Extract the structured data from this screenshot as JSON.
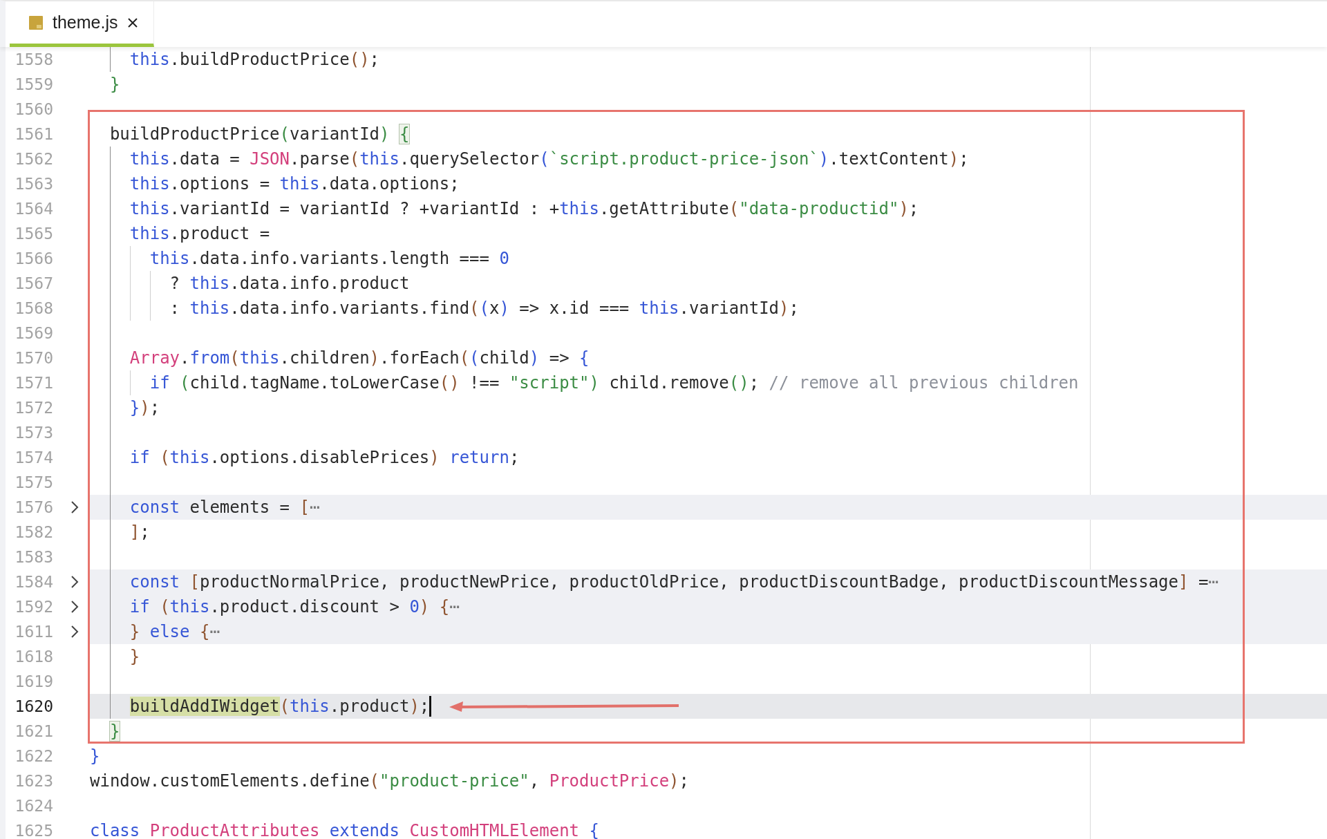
{
  "tabs": [
    {
      "label": "theme.js",
      "selected": true
    }
  ],
  "editor": {
    "lines": [
      {
        "number": "1558",
        "folded": false,
        "current": false,
        "tokens": [
          {
            "text": "    this",
            "kind": "kw"
          },
          {
            "text": ".buildProductPrice",
            "kind": "plain"
          },
          {
            "text": "()",
            "kind": "b1"
          },
          {
            "text": ";",
            "kind": "plain"
          }
        ]
      },
      {
        "number": "1559",
        "folded": false,
        "current": false,
        "tokens": [
          {
            "text": "  }",
            "kind": "b3"
          }
        ]
      },
      {
        "number": "1560",
        "folded": false,
        "current": false
      },
      {
        "number": "1561",
        "folded": false,
        "current": false,
        "tokens": [
          {
            "text": "  buildProductPrice",
            "kind": "plain"
          },
          {
            "text": "(",
            "kind": "b3"
          },
          {
            "text": "variantId",
            "kind": "plain"
          },
          {
            "text": ") ",
            "kind": "b3"
          },
          {
            "text": "{",
            "kind": "match"
          }
        ]
      },
      {
        "number": "1562",
        "folded": false,
        "current": false,
        "tokens": [
          {
            "text": "    this",
            "kind": "kw"
          },
          {
            "text": ".data = ",
            "kind": "plain"
          },
          {
            "text": "JSON",
            "kind": "type"
          },
          {
            "text": ".parse",
            "kind": "plain"
          },
          {
            "text": "(",
            "kind": "b1"
          },
          {
            "text": "this",
            "kind": "kw"
          },
          {
            "text": ".querySelector",
            "kind": "plain"
          },
          {
            "text": "(",
            "kind": "b2"
          },
          {
            "text": "`script.product-price-json`",
            "kind": "str"
          },
          {
            "text": ")",
            "kind": "b2"
          },
          {
            "text": ".textContent",
            "kind": "plain"
          },
          {
            "text": ")",
            "kind": "b1"
          },
          {
            "text": ";",
            "kind": "plain"
          }
        ]
      },
      {
        "number": "1563",
        "folded": false,
        "current": false,
        "tokens": [
          {
            "text": "    this",
            "kind": "kw"
          },
          {
            "text": ".options = ",
            "kind": "plain"
          },
          {
            "text": "this",
            "kind": "kw"
          },
          {
            "text": ".data.options;",
            "kind": "plain"
          }
        ]
      },
      {
        "number": "1564",
        "folded": false,
        "current": false,
        "tokens": [
          {
            "text": "    this",
            "kind": "kw"
          },
          {
            "text": ".variantId = variantId ? +variantId : +",
            "kind": "plain"
          },
          {
            "text": "this",
            "kind": "kw"
          },
          {
            "text": ".getAttribute",
            "kind": "plain"
          },
          {
            "text": "(",
            "kind": "b1"
          },
          {
            "text": "\"data-productid\"",
            "kind": "str"
          },
          {
            "text": ")",
            "kind": "b1"
          },
          {
            "text": ";",
            "kind": "plain"
          }
        ]
      },
      {
        "number": "1565",
        "folded": false,
        "current": false,
        "tokens": [
          {
            "text": "    this",
            "kind": "kw"
          },
          {
            "text": ".product =",
            "kind": "plain"
          }
        ]
      },
      {
        "number": "1566",
        "folded": false,
        "current": false,
        "tokens": [
          {
            "text": "      this",
            "kind": "kw"
          },
          {
            "text": ".data.info.variants.length === ",
            "kind": "plain"
          },
          {
            "text": "0",
            "kind": "num"
          }
        ]
      },
      {
        "number": "1567",
        "folded": false,
        "current": false,
        "tokens": [
          {
            "text": "        ? ",
            "kind": "plain"
          },
          {
            "text": "this",
            "kind": "kw"
          },
          {
            "text": ".data.info.product",
            "kind": "plain"
          }
        ]
      },
      {
        "number": "1568",
        "folded": false,
        "current": false,
        "tokens": [
          {
            "text": "        : ",
            "kind": "plain"
          },
          {
            "text": "this",
            "kind": "kw"
          },
          {
            "text": ".data.info.variants.find",
            "kind": "plain"
          },
          {
            "text": "(",
            "kind": "b1"
          },
          {
            "text": "(",
            "kind": "b2"
          },
          {
            "text": "x",
            "kind": "plain"
          },
          {
            "text": ")",
            "kind": "b2"
          },
          {
            "text": " => x.id === ",
            "kind": "plain"
          },
          {
            "text": "this",
            "kind": "kw"
          },
          {
            "text": ".variantId",
            "kind": "plain"
          },
          {
            "text": ")",
            "kind": "b1"
          },
          {
            "text": ";",
            "kind": "plain"
          }
        ]
      },
      {
        "number": "1569",
        "folded": false,
        "current": false
      },
      {
        "number": "1570",
        "folded": false,
        "current": false,
        "tokens": [
          {
            "text": "    Array",
            "kind": "type"
          },
          {
            "text": ".",
            "kind": "plain"
          },
          {
            "text": "from",
            "kind": "kw"
          },
          {
            "text": "(",
            "kind": "b1"
          },
          {
            "text": "this",
            "kind": "kw"
          },
          {
            "text": ".children",
            "kind": "plain"
          },
          {
            "text": ")",
            "kind": "b1"
          },
          {
            "text": ".forEach",
            "kind": "plain"
          },
          {
            "text": "(",
            "kind": "b1"
          },
          {
            "text": "(",
            "kind": "b2"
          },
          {
            "text": "child",
            "kind": "plain"
          },
          {
            "text": ")",
            "kind": "b2"
          },
          {
            "text": " => ",
            "kind": "plain"
          },
          {
            "text": "{",
            "kind": "b2"
          }
        ]
      },
      {
        "number": "1571",
        "folded": false,
        "current": false,
        "tokens": [
          {
            "text": "      if ",
            "kind": "kw"
          },
          {
            "text": "(",
            "kind": "b3"
          },
          {
            "text": "child.tagName.toLowerCase",
            "kind": "plain"
          },
          {
            "text": "()",
            "kind": "b1"
          },
          {
            "text": " !== ",
            "kind": "plain"
          },
          {
            "text": "\"script\"",
            "kind": "str"
          },
          {
            "text": ")",
            "kind": "b3"
          },
          {
            "text": " child.remove",
            "kind": "plain"
          },
          {
            "text": "()",
            "kind": "b3"
          },
          {
            "text": "; ",
            "kind": "plain"
          },
          {
            "text": "// remove all previous children",
            "kind": "comment"
          }
        ]
      },
      {
        "number": "1572",
        "folded": false,
        "current": false,
        "tokens": [
          {
            "text": "    }",
            "kind": "b2"
          },
          {
            "text": ")",
            "kind": "b1"
          },
          {
            "text": ";",
            "kind": "plain"
          }
        ]
      },
      {
        "number": "1573",
        "folded": false,
        "current": false
      },
      {
        "number": "1574",
        "folded": false,
        "current": false,
        "tokens": [
          {
            "text": "    if ",
            "kind": "kw"
          },
          {
            "text": "(",
            "kind": "b1"
          },
          {
            "text": "this",
            "kind": "kw"
          },
          {
            "text": ".options.disablePrices",
            "kind": "plain"
          },
          {
            "text": ") ",
            "kind": "b1"
          },
          {
            "text": "return",
            "kind": "kw"
          },
          {
            "text": ";",
            "kind": "plain"
          }
        ]
      },
      {
        "number": "1575",
        "folded": false,
        "current": false
      },
      {
        "number": "1576",
        "folded": true,
        "current": false,
        "tokens": [
          {
            "text": "    const",
            "kind": "kw"
          },
          {
            "text": " elements = ",
            "kind": "plain"
          },
          {
            "text": "[",
            "kind": "b1"
          },
          {
            "text": "⋯",
            "kind": "fold"
          }
        ]
      },
      {
        "number": "1582",
        "folded": false,
        "current": false,
        "tokens": [
          {
            "text": "    ]",
            "kind": "b1"
          },
          {
            "text": ";",
            "kind": "plain"
          }
        ]
      },
      {
        "number": "1583",
        "folded": false,
        "current": false
      },
      {
        "number": "1584",
        "folded": true,
        "current": false,
        "tokens": [
          {
            "text": "    const ",
            "kind": "kw"
          },
          {
            "text": "[",
            "kind": "b1"
          },
          {
            "text": "productNormalPrice, productNewPrice, productOldPrice, productDiscountBadge, productDiscountMessage",
            "kind": "plain"
          },
          {
            "text": "]",
            "kind": "b1"
          },
          {
            "text": " =",
            "kind": "plain"
          },
          {
            "text": "⋯",
            "kind": "fold"
          }
        ]
      },
      {
        "number": "1592",
        "folded": true,
        "current": false,
        "tokens": [
          {
            "text": "    if ",
            "kind": "kw"
          },
          {
            "text": "(",
            "kind": "b1"
          },
          {
            "text": "this",
            "kind": "kw"
          },
          {
            "text": ".product.discount > ",
            "kind": "plain"
          },
          {
            "text": "0",
            "kind": "num"
          },
          {
            "text": ") ",
            "kind": "b1"
          },
          {
            "text": "{",
            "kind": "b1"
          },
          {
            "text": "⋯",
            "kind": "fold"
          }
        ]
      },
      {
        "number": "1611",
        "folded": true,
        "current": false,
        "tokens": [
          {
            "text": "    } ",
            "kind": "b1"
          },
          {
            "text": "else ",
            "kind": "kw"
          },
          {
            "text": "{",
            "kind": "b1"
          },
          {
            "text": "⋯",
            "kind": "fold"
          }
        ]
      },
      {
        "number": "1618",
        "folded": false,
        "current": false,
        "tokens": [
          {
            "text": "    }",
            "kind": "b1"
          }
        ]
      },
      {
        "number": "1619",
        "folded": false,
        "current": false
      },
      {
        "number": "1620",
        "folded": false,
        "current": true,
        "tokens": [
          {
            "text": "    buildAddIWidget",
            "kind": "hl"
          },
          {
            "text": "(",
            "kind": "b1"
          },
          {
            "text": "this",
            "kind": "kw"
          },
          {
            "text": ".product",
            "kind": "plain"
          },
          {
            "text": ")",
            "kind": "b1"
          },
          {
            "text": ";",
            "kind": "plain"
          }
        ]
      },
      {
        "number": "1621",
        "folded": false,
        "current": false,
        "tokens": [
          {
            "text": "  }",
            "kind": "match"
          }
        ]
      },
      {
        "number": "1622",
        "folded": false,
        "current": false,
        "tokens": [
          {
            "text": "}",
            "kind": "b2"
          }
        ]
      },
      {
        "number": "1623",
        "folded": false,
        "current": false,
        "tokens": [
          {
            "text": "window.customElements.define",
            "kind": "plain"
          },
          {
            "text": "(",
            "kind": "b1"
          },
          {
            "text": "\"product-price\"",
            "kind": "str"
          },
          {
            "text": ", ",
            "kind": "plain"
          },
          {
            "text": "ProductPrice",
            "kind": "type"
          },
          {
            "text": ")",
            "kind": "b1"
          },
          {
            "text": ";",
            "kind": "plain"
          }
        ]
      },
      {
        "number": "1624",
        "folded": false,
        "current": false
      },
      {
        "number": "1625",
        "folded": false,
        "current": false,
        "tokens": [
          {
            "text": "class ",
            "kind": "kw"
          },
          {
            "text": "ProductAttributes ",
            "kind": "type"
          },
          {
            "text": "extends ",
            "kind": "kw"
          },
          {
            "text": "CustomHTMLElement ",
            "kind": "type"
          },
          {
            "text": "{",
            "kind": "b2"
          }
        ]
      }
    ]
  }
}
